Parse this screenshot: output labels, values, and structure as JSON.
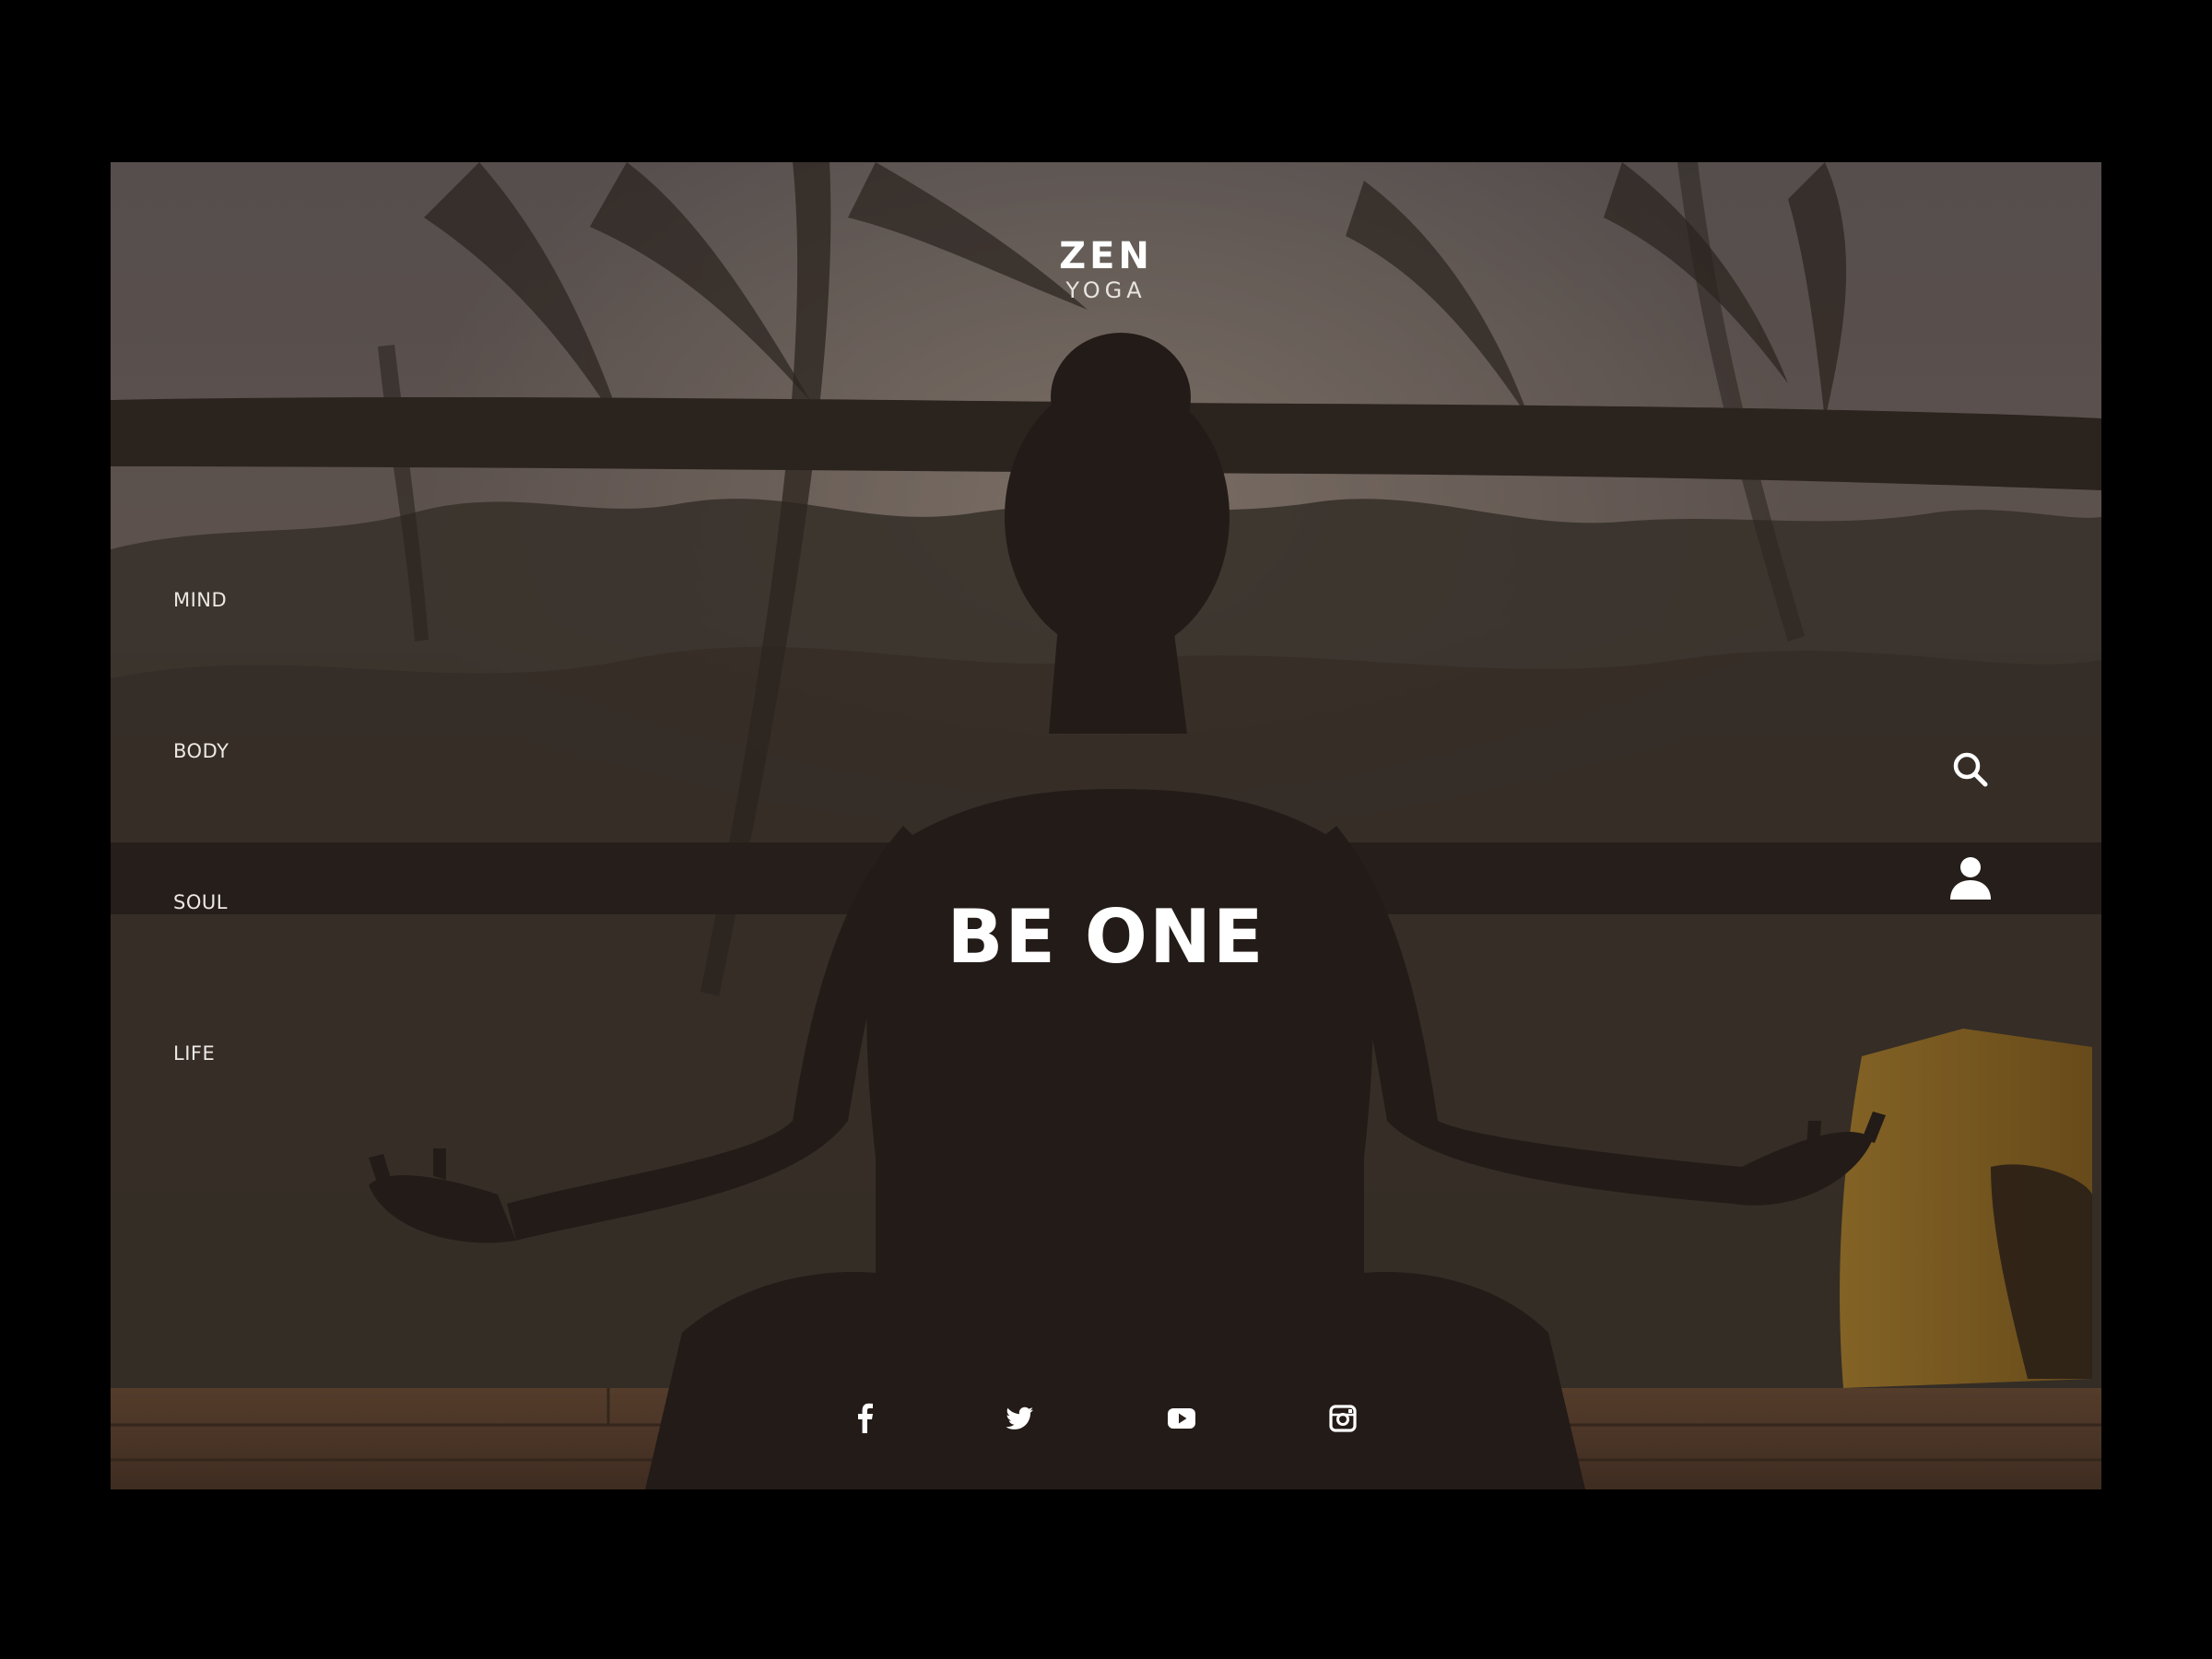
{
  "brand": {
    "name": "ZEN",
    "tagline": "YOGA"
  },
  "nav": {
    "items": [
      {
        "label": "MIND"
      },
      {
        "label": "BODY"
      },
      {
        "label": "SOUL"
      },
      {
        "label": "LIFE"
      }
    ]
  },
  "hero": {
    "headline": "BE ONE",
    "background": "silhouette of a person meditating in lotus pose facing palm trees at sunset",
    "overlay_color": "#2b221d"
  },
  "actions": {
    "search_icon": "search-icon",
    "account_icon": "user-icon"
  },
  "social": [
    {
      "icon": "facebook-icon"
    },
    {
      "icon": "twitter-icon"
    },
    {
      "icon": "youtube-icon"
    },
    {
      "icon": "instagram-icon"
    }
  ],
  "colors": {
    "page_background": "#000000",
    "text": "#ffffff",
    "accent_mat": "#d09a2a"
  }
}
